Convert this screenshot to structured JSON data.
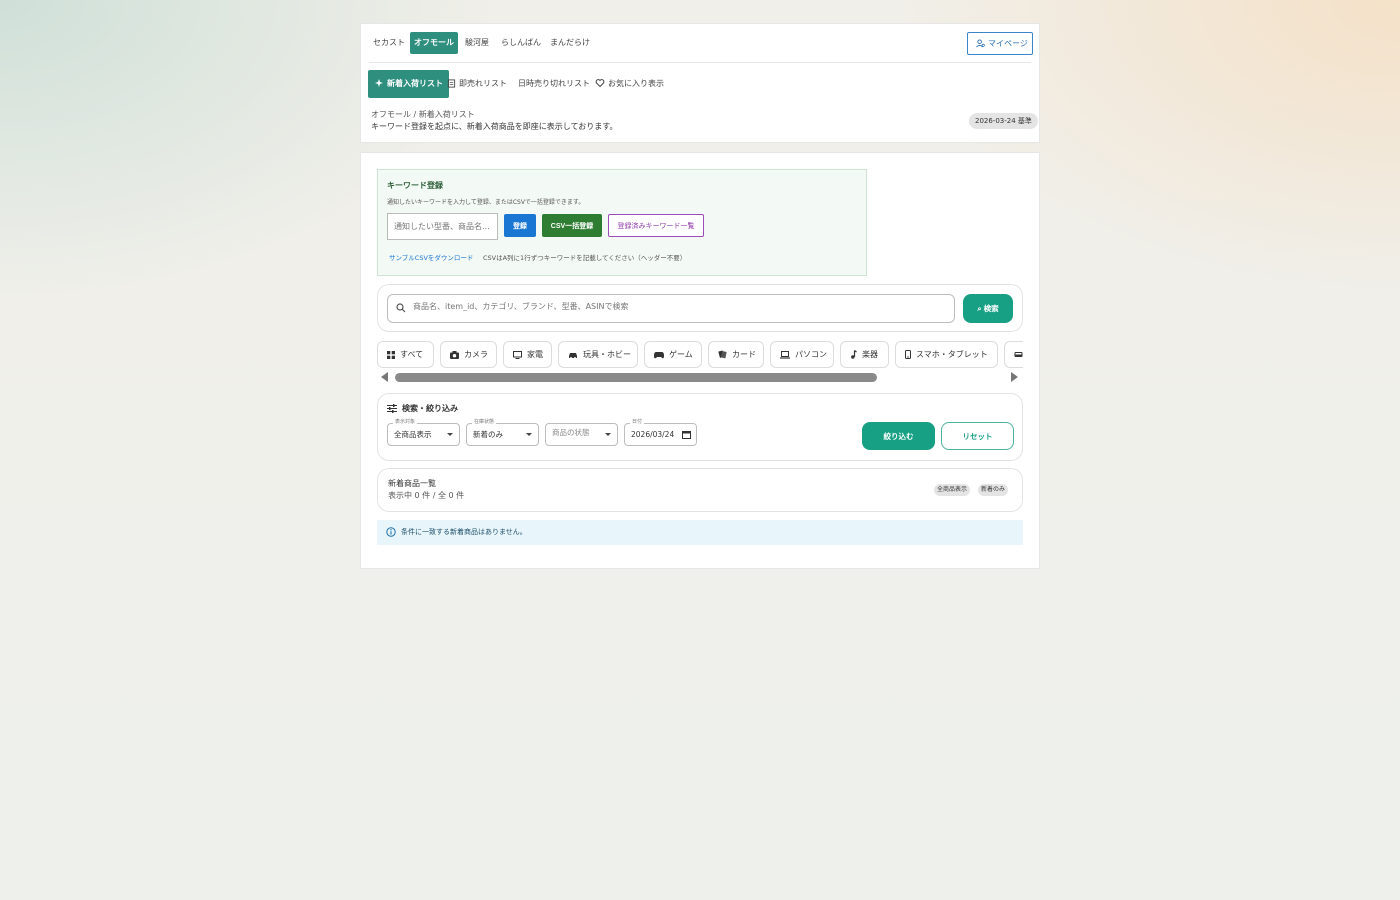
{
  "top_tabs": [
    "セカスト",
    "オフモール",
    "駿河屋",
    "らしんばん",
    "まんだらけ"
  ],
  "mypage_label": "マイページ",
  "sub_tabs": [
    "新着入荷リスト",
    "即売れリスト",
    "日時売り切れリスト",
    "お気に入り表示"
  ],
  "breadcrumb": "オフモール / 新着入荷リスト",
  "description": "キーワード登録を起点に、新着入荷商品を即座に表示しております。",
  "date_badge": "2026-03-24 基準",
  "keyword": {
    "title": "キーワード登録",
    "help": "通知したいキーワードを入力して登録、またはCSVで一括登録できます。",
    "placeholder": "通知したい型番、商品名...",
    "register": "登録",
    "csv": "CSV一括登録",
    "list": "登録済みキーワード一覧",
    "sample_link": "サンプルCSVをダウンロード",
    "note": "CSVはA列に1行ずつキーワードを記載してください（ヘッダー不要）"
  },
  "search": {
    "placeholder": "商品名、item_id、カテゴリ、ブランド、型番、ASINで検索",
    "button": "検索"
  },
  "categories": [
    "すべて",
    "カメラ",
    "家電",
    "玩具・ホビー",
    "ゲーム",
    "カード",
    "パソコン",
    "楽器",
    "スマホ・タブレット"
  ],
  "filter": {
    "title": "検索・絞り込み",
    "display_label": "表示対象",
    "display_value": "全商品表示",
    "stock_label": "在庫状態",
    "stock_value": "新着のみ",
    "condition_placeholder": "商品の状態",
    "date_label": "日付",
    "date_value": "2026/03/24",
    "apply": "絞り込む",
    "reset": "リセット"
  },
  "list": {
    "title": "新着商品一覧",
    "count": "表示中 0 件 / 全 0 件",
    "chips": [
      "全商品表示",
      "新着のみ"
    ]
  },
  "info": "条件に一致する新着商品はありません。",
  "colors": {
    "accent": "#18a085",
    "tab_active": "#2f8f7f",
    "register": "#1976d2",
    "csv": "#2e7d32"
  }
}
